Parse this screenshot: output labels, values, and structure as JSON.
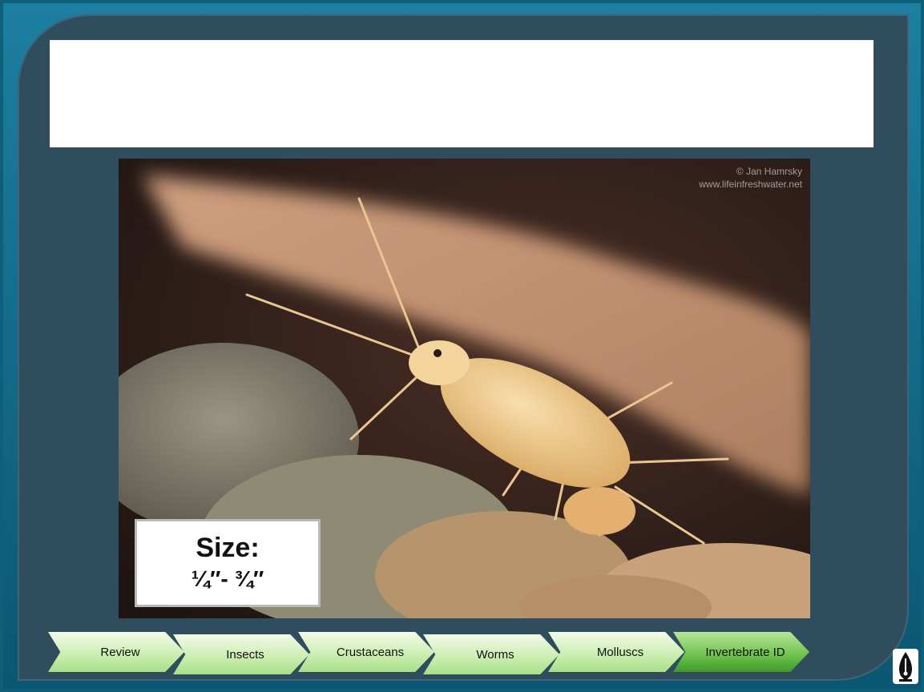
{
  "slide": {
    "title": "",
    "photo_credit_line1": "© Jan Hamrsky",
    "photo_credit_line2": "www.lifeinfreshwater.net",
    "size_label": "Size:",
    "size_value": "¼″- ¾″"
  },
  "nav": {
    "items": [
      {
        "label": "Review"
      },
      {
        "label": "Insects"
      },
      {
        "label": "Crustaceans"
      },
      {
        "label": "Worms"
      },
      {
        "label": "Molluscs"
      },
      {
        "label": "Invertebrate ID"
      }
    ],
    "active_index": 5
  },
  "icons": {
    "logo": "pen-nib-logo-icon"
  },
  "colors": {
    "background": "#0e5f7a",
    "panel": "#2f4d5d",
    "nav_green": "#cdeeb3",
    "nav_active": "#6cc14a"
  }
}
